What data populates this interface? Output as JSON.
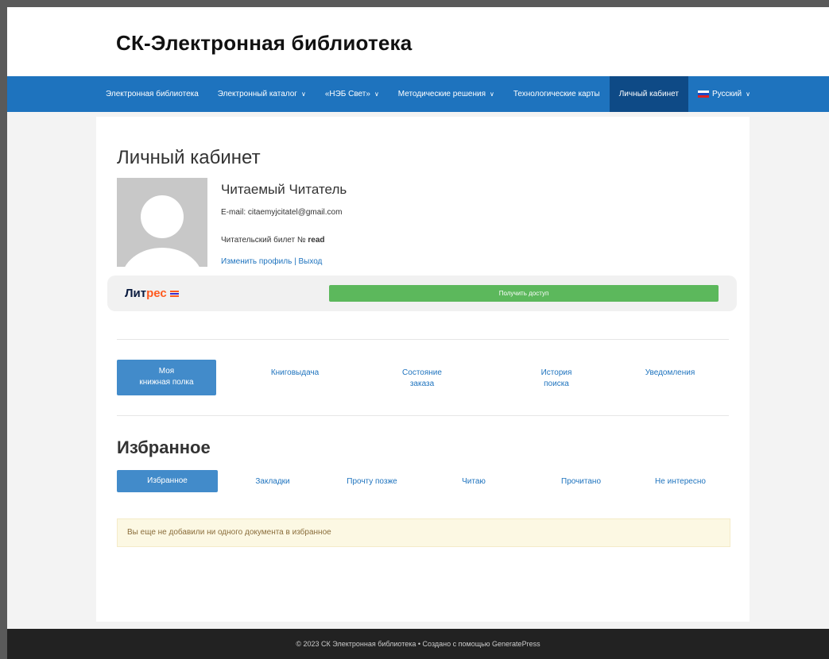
{
  "site": {
    "title": "СК-Электронная библиотека"
  },
  "nav": {
    "items": [
      {
        "label": "Электронная библиотека",
        "dropdown": false
      },
      {
        "label": "Электронный каталог",
        "dropdown": true
      },
      {
        "label": "«НЭБ Свет»",
        "dropdown": true
      },
      {
        "label": "Методические решения",
        "dropdown": true
      },
      {
        "label": "Технологические карты",
        "dropdown": false
      },
      {
        "label": "Личный кабинет",
        "dropdown": false,
        "active": true
      }
    ],
    "language": {
      "label": "Русский",
      "icon": "russian-flag-icon"
    }
  },
  "profile": {
    "page_title": "Личный кабинет",
    "name": "Читаемый Читатель",
    "email": "E-mail: citaemyjcitatel@gmail.com",
    "ticket_prefix": "Читательский билет №",
    "ticket_value": "read",
    "edit_link": "Изменить профиль",
    "separator": "|",
    "logout_link": "Выход"
  },
  "litres": {
    "logo_part1": "Лит",
    "logo_part2": "рес",
    "access_button": "Получить доступ"
  },
  "account_tabs": [
    {
      "line1": "Моя",
      "line2": "книжная полка",
      "active": true
    },
    {
      "line1": "Книговыдача",
      "line2": ""
    },
    {
      "line1": "Состояние",
      "line2": "заказа"
    },
    {
      "line1": "История",
      "line2": "поиска"
    },
    {
      "line1": "Уведомления",
      "line2": ""
    }
  ],
  "favorites": {
    "title": "Избранное",
    "tabs": [
      "Избранное",
      "Закладки",
      "Прочту позже",
      "Читаю",
      "Прочитано",
      "Не интересно"
    ],
    "notice": "Вы еще не добавили ни одного документа в избранное"
  },
  "footer": {
    "text": "© 2023 СК Электронная библиотека • Создано с помощью GeneratePress"
  },
  "colors": {
    "nav": "#1e73be",
    "nav_active": "#0e4a86",
    "access": "#5cb85c",
    "tab_active": "#428bca"
  }
}
